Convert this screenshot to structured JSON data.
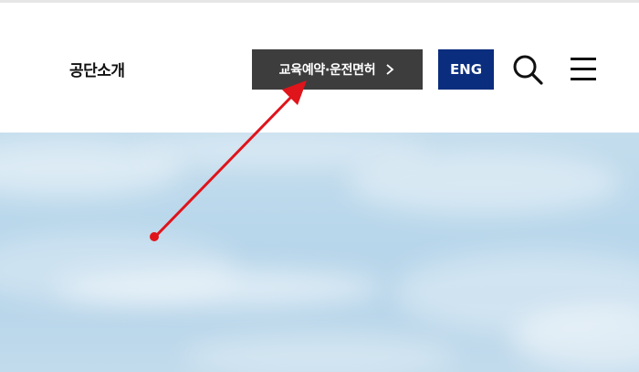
{
  "header": {
    "nav_link": "공단소개",
    "booking_button": "교육예약·운전면허",
    "lang_button": "ENG"
  },
  "icons": {
    "booking_chevron": "chevron-right-icon",
    "search": "search-icon",
    "menu": "hamburger-menu-icon"
  },
  "colors": {
    "booking_bg": "#3d3d3d",
    "lang_bg": "#0b2d7e",
    "annotation_red": "#e0141b",
    "hero_sky": "#b9d7eb"
  }
}
